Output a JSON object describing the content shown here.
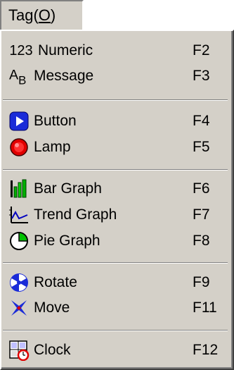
{
  "menu": {
    "title": "Tag(",
    "title_mnemonic": "O",
    "title_close": ")"
  },
  "items": [
    {
      "icon_text": "123",
      "label": "Numeric",
      "shortcut": "F2",
      "icon": "numeric-icon"
    },
    {
      "icon_text": "AB",
      "label": "Message",
      "shortcut": "F3",
      "icon": "message-icon"
    },
    {
      "label": "Button",
      "shortcut": "F4",
      "icon": "button-icon"
    },
    {
      "label": "Lamp",
      "shortcut": "F5",
      "icon": "lamp-icon"
    },
    {
      "label": "Bar Graph",
      "shortcut": "F6",
      "icon": "bar-graph-icon"
    },
    {
      "label": "Trend Graph",
      "shortcut": "F7",
      "icon": "trend-graph-icon"
    },
    {
      "label": "Pie Graph",
      "shortcut": "F8",
      "icon": "pie-graph-icon"
    },
    {
      "label": "Rotate",
      "shortcut": "F9",
      "icon": "rotate-icon"
    },
    {
      "label": "Move",
      "shortcut": "F11",
      "icon": "move-icon"
    },
    {
      "label": "Clock",
      "shortcut": "F12",
      "icon": "clock-icon"
    }
  ],
  "colors": {
    "menu_bg": "#d4d0c8",
    "button_blue": "#1a2bd8",
    "lamp_red": "#e00000",
    "graph_green": "#00b000"
  }
}
